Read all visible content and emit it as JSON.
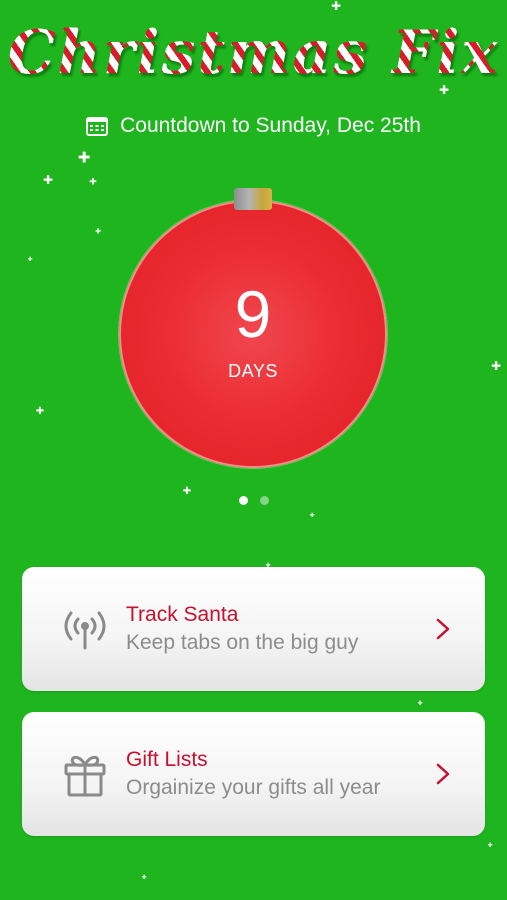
{
  "app": {
    "title": "Christmas Fix"
  },
  "header": {
    "countdown_text": "Countdown to Sunday, Dec 25th",
    "calendar_icon": "calendar-icon"
  },
  "countdown": {
    "value": "9",
    "unit": "DAYS"
  },
  "pager": {
    "pages": 2,
    "active_index": 0
  },
  "cards": [
    {
      "title": "Track Santa",
      "subtitle": "Keep tabs on the big guy",
      "icon": "radio-tower-icon"
    },
    {
      "title": "Gift Lists",
      "subtitle": "Orgainize your gifts all year",
      "icon": "gift-icon"
    }
  ],
  "colors": {
    "background": "#1fb51f",
    "ornament": "#e8272d",
    "card_title": "#c8102e",
    "card_subtitle": "#8c8c8c",
    "text_on_green": "#ffffff"
  }
}
